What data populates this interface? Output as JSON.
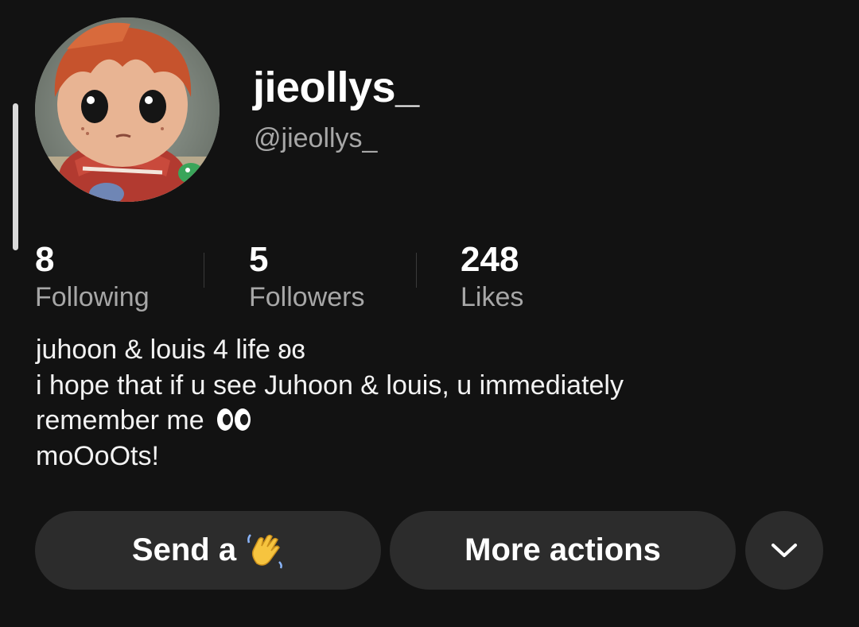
{
  "profile": {
    "display_name": "jieollys_",
    "handle": "@jieollys_",
    "avatar_icon": "vinyl-figure-avatar"
  },
  "stats": [
    {
      "value": "8",
      "label": "Following"
    },
    {
      "value": "5",
      "label": "Followers"
    },
    {
      "value": "248",
      "label": "Likes"
    }
  ],
  "bio": {
    "line1": "juhoon & louis 4 life ʚɞ",
    "line2": "i hope that if u see Juhoon & louis, u immediately",
    "line3": "remember me",
    "line3_icon": "eyes-emoji",
    "line4": "moOoOts!"
  },
  "actions": {
    "send_label": "Send a",
    "send_icon": "waving-hand-emoji",
    "more_label": "More actions",
    "expand_icon": "chevron-down"
  },
  "colors": {
    "background": "#121212",
    "button": "#2c2c2c",
    "secondary_text": "#a7a7a7"
  }
}
